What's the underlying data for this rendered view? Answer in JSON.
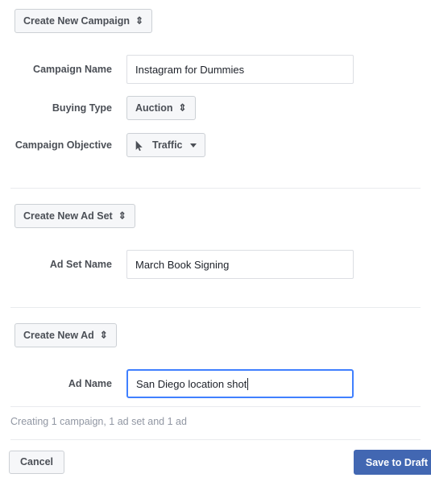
{
  "colors": {
    "primary_button": "#4267b2",
    "focus_border": "#4080ff",
    "label_text": "#4b4f56",
    "status_text": "#9197a3",
    "divider": "#e9ebee",
    "button_face": "#f6f7f9",
    "button_border": "#ccd0d5",
    "input_border": "#dcdee3",
    "input_text": "#1d2129"
  },
  "campaign_section": {
    "create_button": {
      "label": "Create New Campaign",
      "glyph": "⇕"
    },
    "name_row": {
      "label": "Campaign Name",
      "value": "Instagram for Dummies",
      "placeholder": ""
    },
    "buying_type_row": {
      "label": "Buying Type",
      "value": "Auction",
      "glyph": "⇕"
    },
    "objective_row": {
      "label": "Campaign Objective",
      "value": "Traffic",
      "icon": "mouse-cursor-icon",
      "caret": "chevron-down-icon"
    }
  },
  "ad_set_section": {
    "create_button": {
      "label": "Create New Ad Set",
      "glyph": "⇕"
    },
    "name_row": {
      "label": "Ad Set Name",
      "value": "March Book Signing",
      "placeholder": ""
    }
  },
  "ad_section": {
    "create_button": {
      "label": "Create New Ad",
      "glyph": "⇕"
    },
    "name_row": {
      "label": "Ad Name",
      "value": "San Diego location shot",
      "placeholder": "",
      "focused": true
    }
  },
  "footer": {
    "status": "Creating 1 campaign, 1 ad set and 1 ad",
    "cancel_label": "Cancel",
    "save_label": "Save to Draft"
  }
}
